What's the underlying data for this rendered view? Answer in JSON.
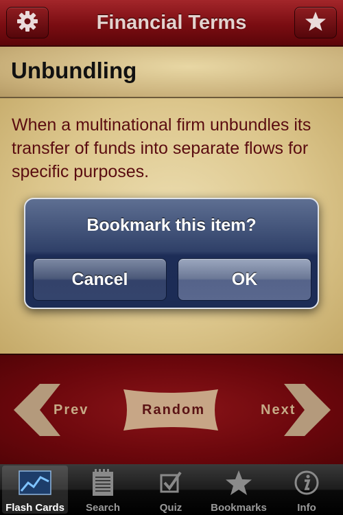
{
  "header": {
    "title": "Financial Terms",
    "left_icon": "gear-icon",
    "right_icon": "star-icon"
  },
  "term": {
    "title": "Unbundling",
    "definition": "When a multinational firm unbundles its transfer of funds into separate flows for specific purposes."
  },
  "navigation": {
    "prev_label": "Prev",
    "random_label": "Random",
    "next_label": "Next"
  },
  "alert": {
    "message": "Bookmark this item?",
    "cancel_label": "Cancel",
    "ok_label": "OK"
  },
  "tabs": [
    {
      "label": "Flash Cards",
      "icon": "chart-icon",
      "active": true
    },
    {
      "label": "Search",
      "icon": "notepad-icon",
      "active": false
    },
    {
      "label": "Quiz",
      "icon": "checkbox-icon",
      "active": false
    },
    {
      "label": "Bookmarks",
      "icon": "star-icon",
      "active": false
    },
    {
      "label": "Info",
      "icon": "info-icon",
      "active": false
    }
  ],
  "colors": {
    "header_red": "#7a0d12",
    "parchment": "#dcc68c",
    "definition_text": "#5a0c10",
    "alert_blue": "#2f4068"
  }
}
